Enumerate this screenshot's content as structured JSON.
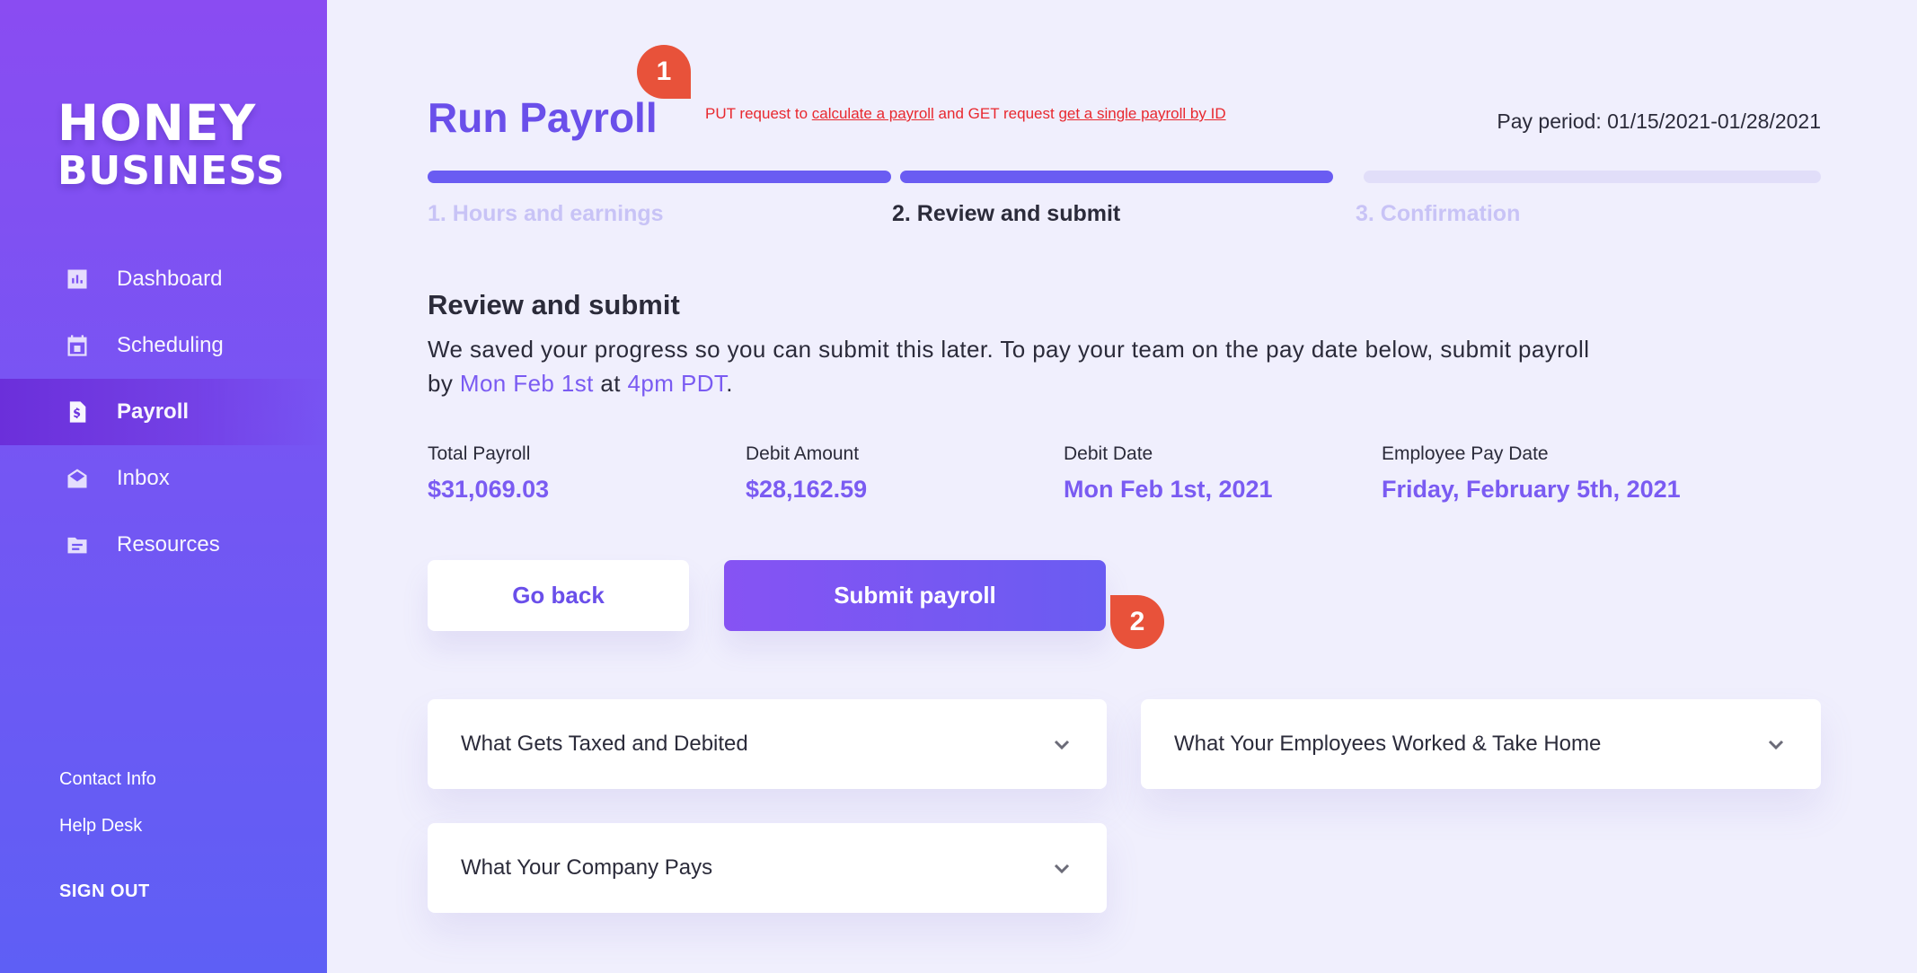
{
  "brand": {
    "line1": "HONEY",
    "line2": "BUSINESS"
  },
  "nav": [
    {
      "label": "Dashboard",
      "icon": "chart-icon"
    },
    {
      "label": "Scheduling",
      "icon": "calendar-icon"
    },
    {
      "label": "Payroll",
      "icon": "dollar-document-icon"
    },
    {
      "label": "Inbox",
      "icon": "envelope-icon"
    },
    {
      "label": "Resources",
      "icon": "folder-icon"
    }
  ],
  "active_nav": "Payroll",
  "footer_links": {
    "contact": "Contact Info",
    "help": "Help Desk",
    "signout": "SIGN OUT"
  },
  "page": {
    "title": "Run Payroll",
    "pay_period": "Pay period: 01/15/2021-01/28/2021",
    "api_note": {
      "prefix": "PUT request to ",
      "link1": "calculate a payroll",
      "middle": " and GET request ",
      "link2": "get a single payroll by ID"
    },
    "badges": {
      "b1": "1",
      "b2": "2"
    }
  },
  "steps": [
    {
      "label": "1. Hours and earnings",
      "state": "done"
    },
    {
      "label": "2. Review and submit",
      "state": "current"
    },
    {
      "label": "3. Confirmation",
      "state": "upcoming"
    }
  ],
  "review": {
    "title": "Review and submit",
    "desc_part1": "We saved your progress so you can submit this later. To pay your team on the pay date below, submit payroll by ",
    "desc_date": "Mon Feb 1st",
    "desc_at": " at ",
    "desc_time": "4pm PDT",
    "desc_end": "."
  },
  "stats": [
    {
      "label": "Total Payroll",
      "value": "$31,069.03"
    },
    {
      "label": "Debit Amount",
      "value": "$28,162.59"
    },
    {
      "label": "Debit Date",
      "value": "Mon Feb 1st, 2021"
    },
    {
      "label": "Employee Pay Date",
      "value": "Friday, February 5th, 2021"
    }
  ],
  "buttons": {
    "back": "Go back",
    "submit": "Submit payroll"
  },
  "accordions": [
    {
      "label": "What Gets Taxed and Debited"
    },
    {
      "label": "What Your Employees Worked & Take Home"
    },
    {
      "label": "What Your Company Pays"
    }
  ],
  "colors": {
    "accent": "#6a4fea",
    "badge": "#e8523a",
    "note": "#e8282e"
  }
}
